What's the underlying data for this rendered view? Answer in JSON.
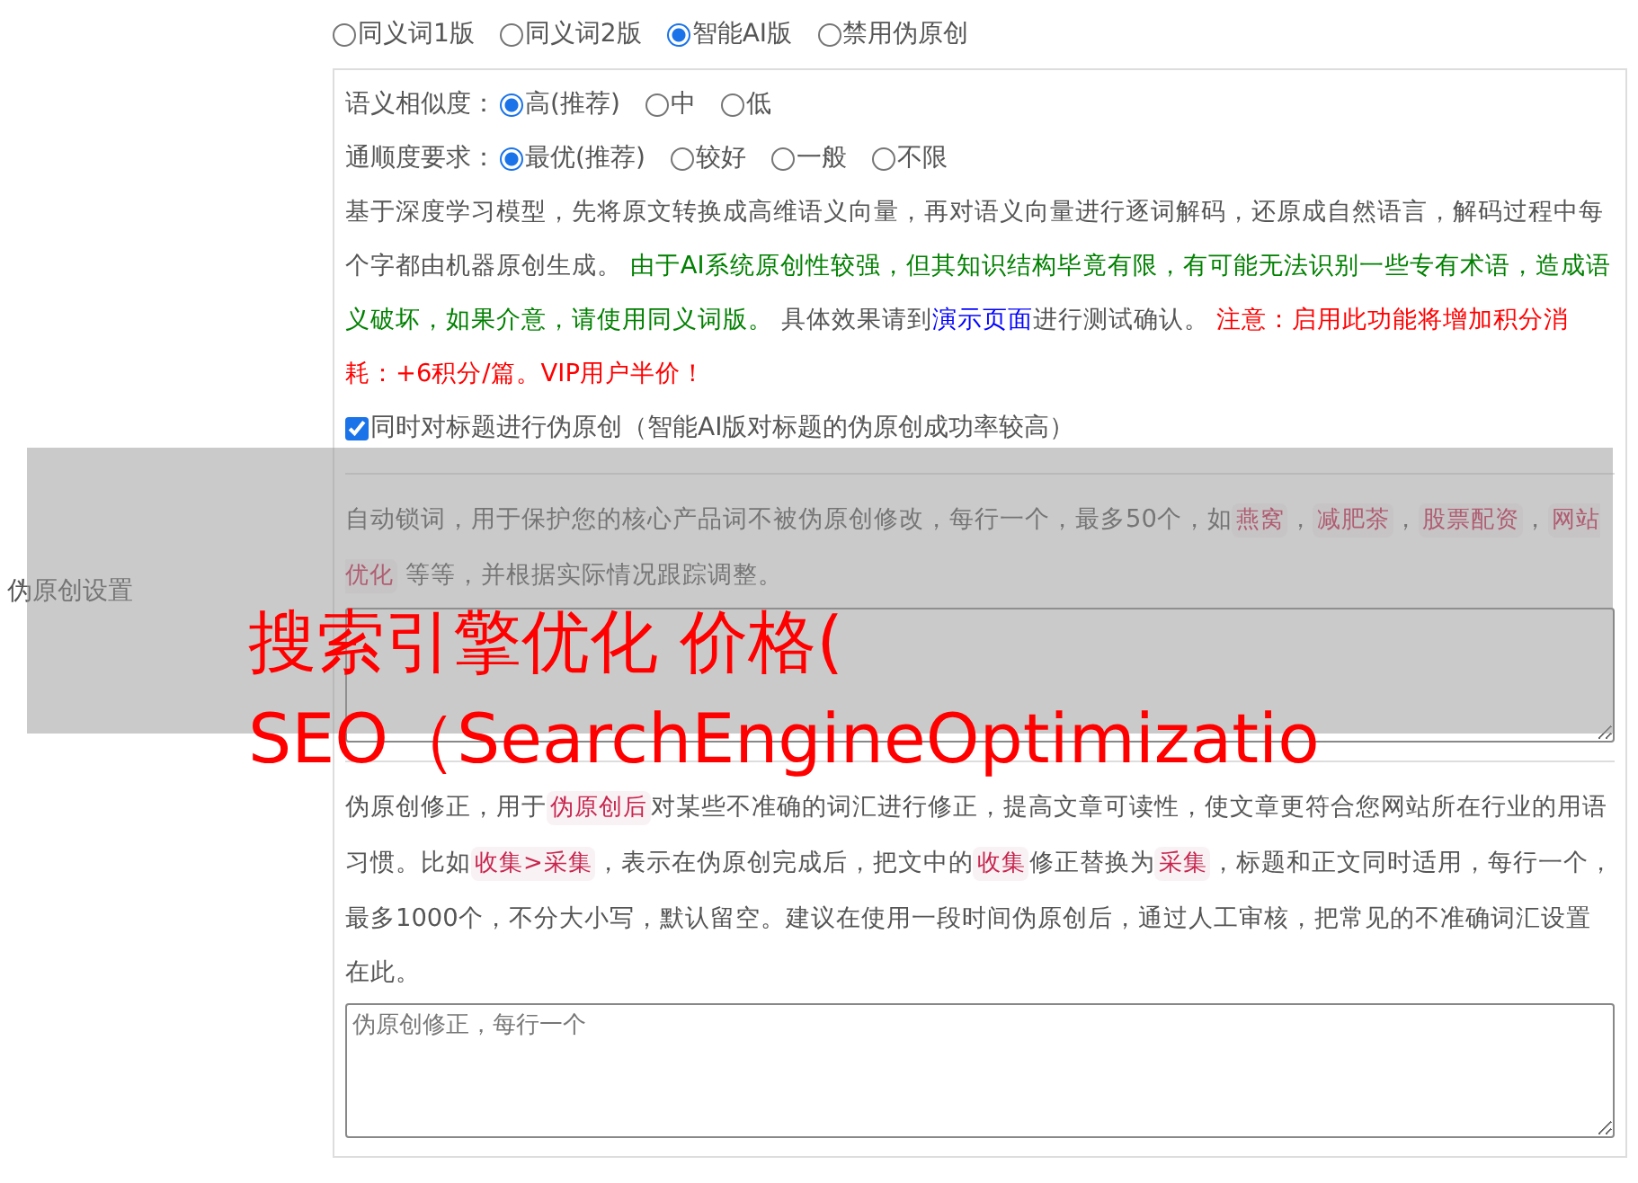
{
  "settings_label": "伪原创设置",
  "mode_options": [
    {
      "label": "同义词1版",
      "selected": false
    },
    {
      "label": "同义词2版",
      "selected": false
    },
    {
      "label": "智能AI版",
      "selected": true
    },
    {
      "label": "禁用伪原创",
      "selected": false
    }
  ],
  "similarity": {
    "label": "语义相似度：",
    "options": [
      {
        "label": "高(推荐)",
        "selected": true
      },
      {
        "label": "中",
        "selected": false
      },
      {
        "label": "低",
        "selected": false
      }
    ]
  },
  "fluency": {
    "label": "通顺度要求：",
    "options": [
      {
        "label": "最优(推荐)",
        "selected": true
      },
      {
        "label": "较好",
        "selected": false
      },
      {
        "label": "一般",
        "selected": false
      },
      {
        "label": "不限",
        "selected": false
      }
    ]
  },
  "ai_description": [
    {
      "kind": "plain",
      "text": "基于深度学习模型，先将原文转换成高维语义向量，再对语义向量进行逐词解码，还原成自然语言，解码过程中每个字都由机器原创生成。 "
    },
    {
      "kind": "note",
      "text": "由于AI系统原创性较强，但其知识结构毕竟有限，有可能无法识别一些专有术语，造成语义破坏，如果介意，请使用同义词版。"
    },
    {
      "kind": "plain",
      "text": " 具体效果请到"
    },
    {
      "kind": "link",
      "text": "演示页面"
    },
    {
      "kind": "plain",
      "text": "进行测试确认。 "
    },
    {
      "kind": "alert",
      "text": "注意：启用此功能将增加积分消耗：+6积分/篇。VIP用户半价！"
    }
  ],
  "title_checkbox": {
    "label": "同时对标题进行伪原创（智能AI版对标题的伪原创成功率较高）",
    "checked": true
  },
  "lock_words": {
    "description": [
      {
        "kind": "plain",
        "text": "自动锁词，用于保护您的核心产品词不被伪原创修改，每行一个，最多50个，如"
      },
      {
        "kind": "tag",
        "text": "燕窝"
      },
      {
        "kind": "plain",
        "text": "，"
      },
      {
        "kind": "tag",
        "text": "减肥茶"
      },
      {
        "kind": "plain",
        "text": "，"
      },
      {
        "kind": "tag",
        "text": "股票配资"
      },
      {
        "kind": "plain",
        "text": "，"
      },
      {
        "kind": "tag",
        "text": "网站优化"
      },
      {
        "kind": "plain",
        "text": " 等等，并根据实际情况跟踪调整。"
      }
    ]
  },
  "correction": {
    "description": [
      {
        "kind": "plain",
        "text": "伪原创修正，用于"
      },
      {
        "kind": "tag",
        "text": "伪原创后"
      },
      {
        "kind": "plain",
        "text": "对某些不准确的词汇进行修正，提高文章可读性，使文章更符合您网站所在行业的用语习惯。比如"
      },
      {
        "kind": "tag",
        "text": "收集>采集"
      },
      {
        "kind": "plain",
        "text": "，表示在伪原创完成后，把文中的"
      },
      {
        "kind": "tag",
        "text": "收集"
      },
      {
        "kind": "plain",
        "text": "修正替换为"
      },
      {
        "kind": "tag",
        "text": "采集"
      },
      {
        "kind": "plain",
        "text": "，标题和正文同时适用，每行一个，最多1000个，不分大小写，默认留空。建议在使用一段时间伪原创后，通过人工审核，把常见的不准确词汇设置在此。"
      }
    ],
    "placeholder": "伪原创修正，每行一个"
  },
  "overlay": {
    "title_lines": [
      "搜索引擎优化 价格(",
      "SEO（SearchEngineOptimizatio"
    ]
  }
}
